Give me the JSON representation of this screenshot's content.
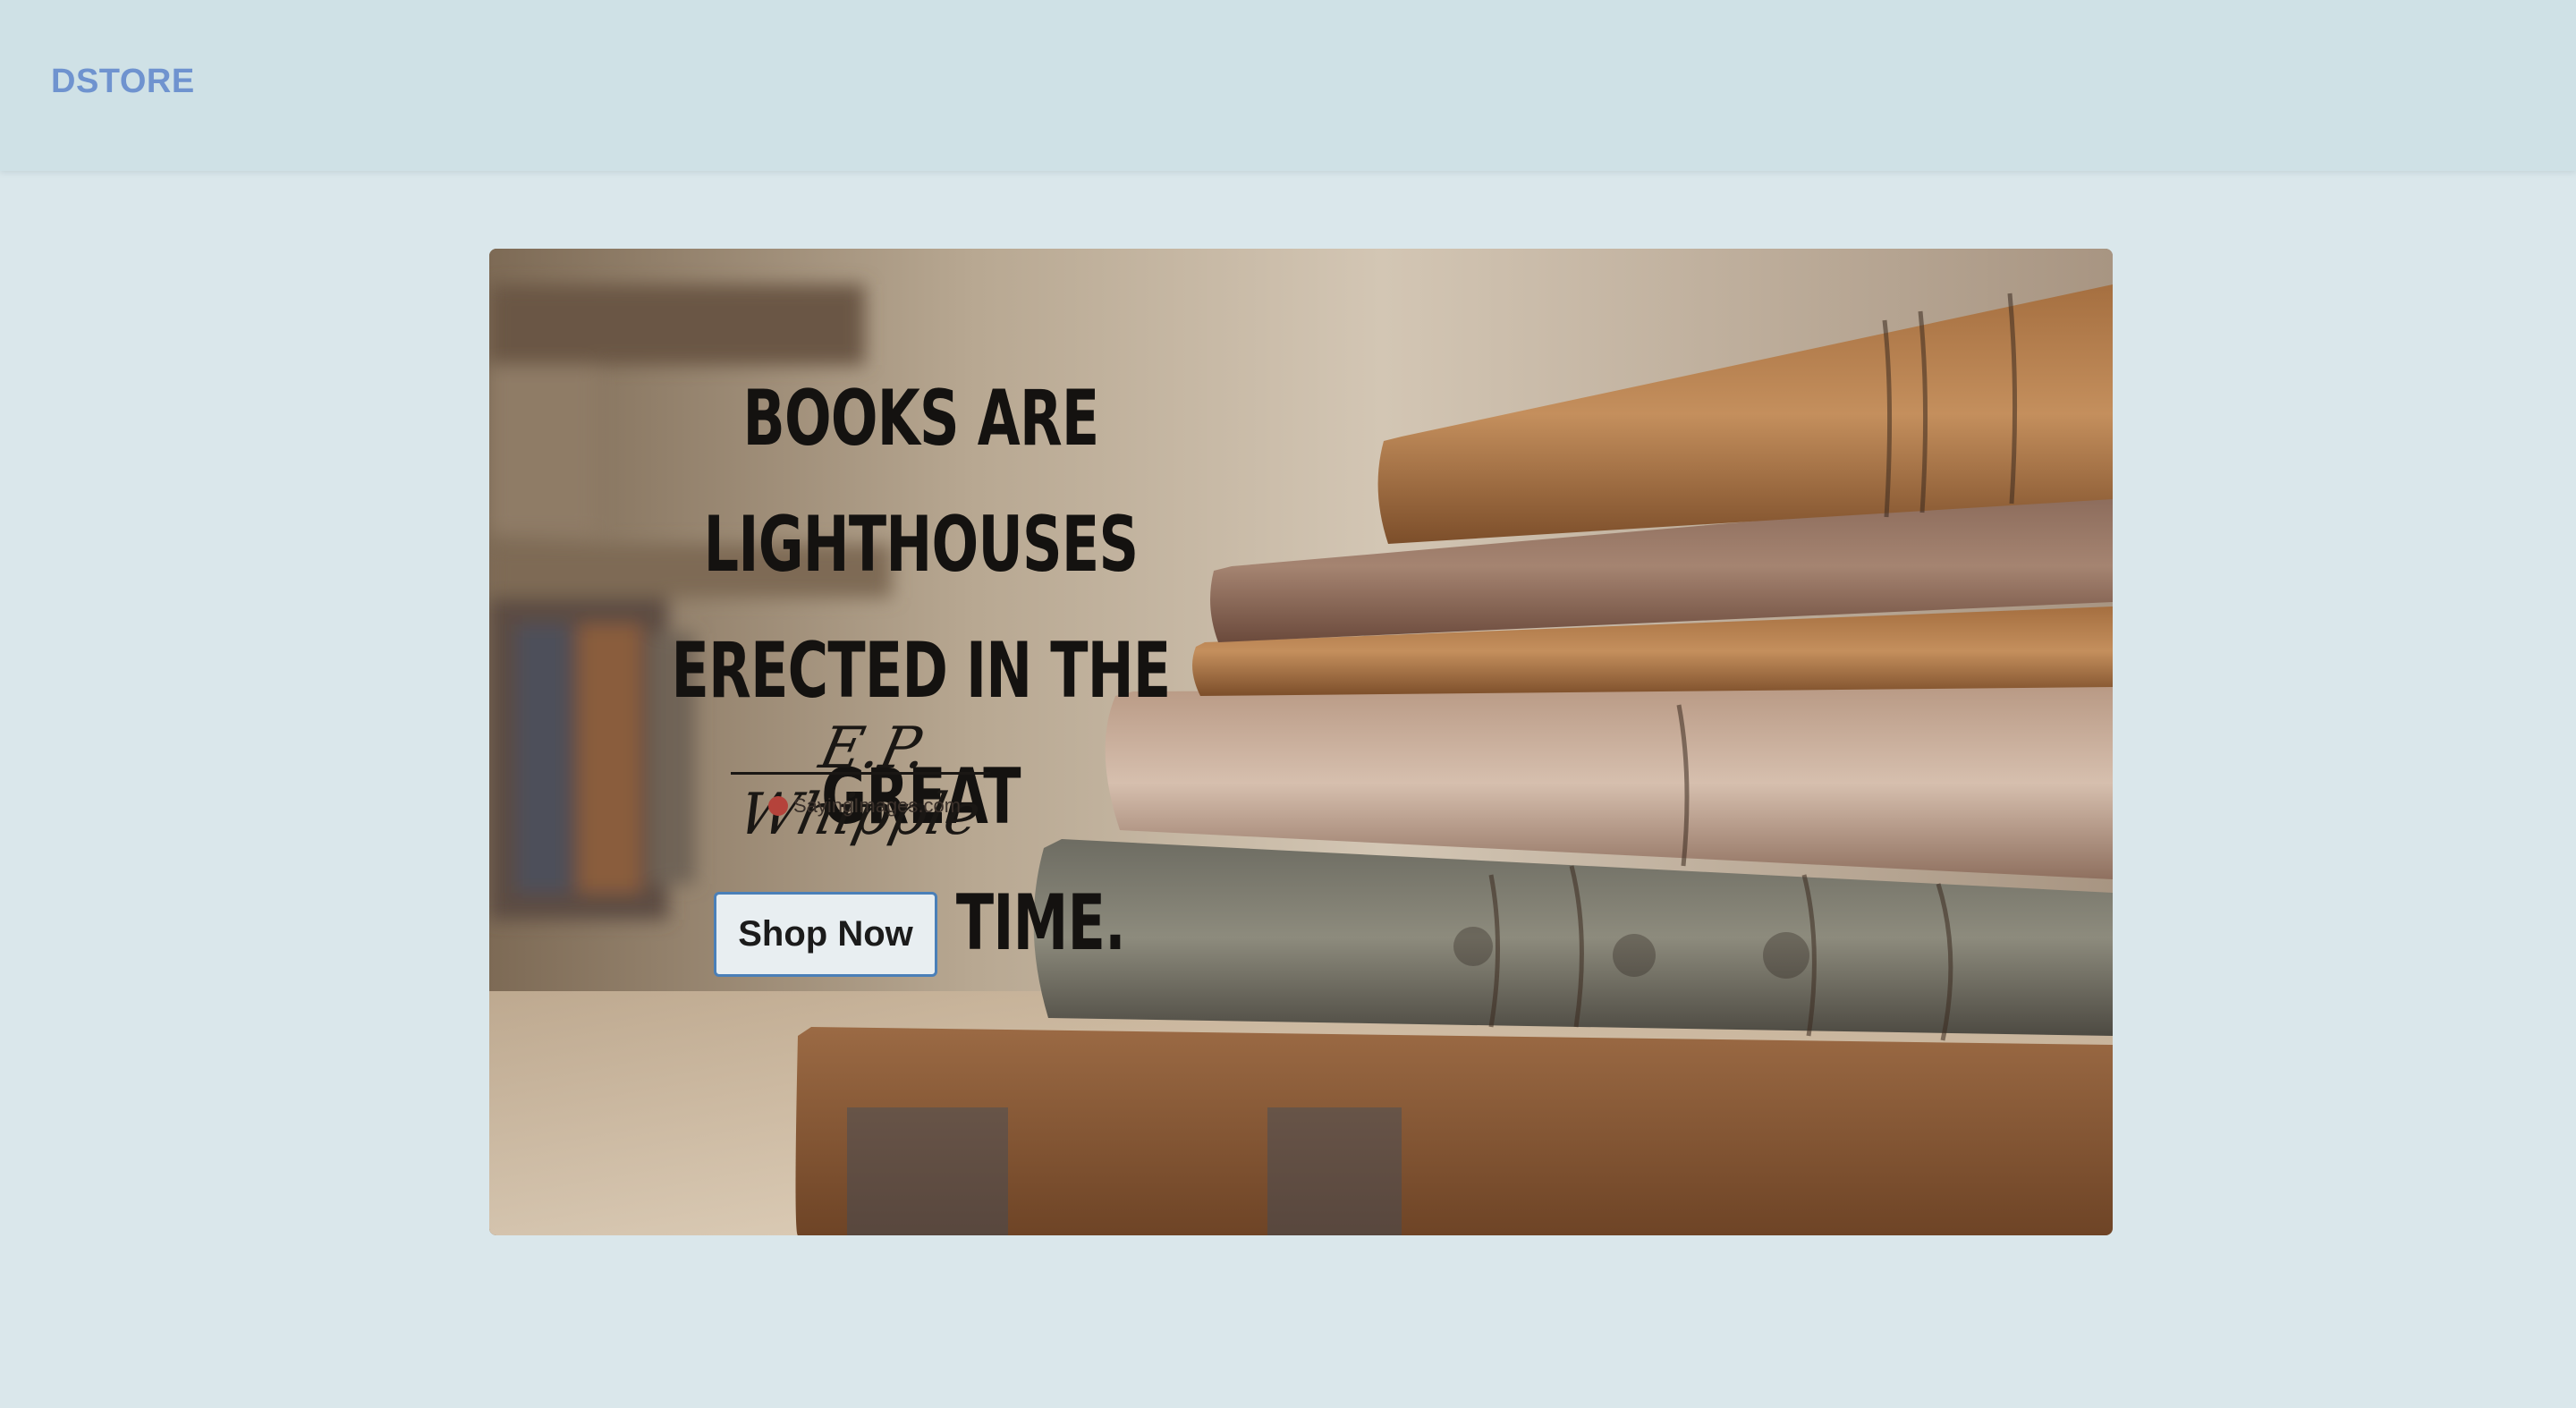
{
  "header": {
    "brand": "DSTORE"
  },
  "hero": {
    "quote_lines": [
      "BOOKS ARE LIGHTHOUSES",
      "ERECTED IN THE GREAT",
      "SEA OF TIME."
    ],
    "author": "E.P. Whipple",
    "watermark": "SayingImages.com",
    "cta_label": "Shop Now"
  },
  "colors": {
    "page_background": "#dae7eb",
    "header_background": "#cfe1e6",
    "brand": "#6f93cf",
    "button_border": "#4a7fb8",
    "button_background": "#e8eef1"
  }
}
